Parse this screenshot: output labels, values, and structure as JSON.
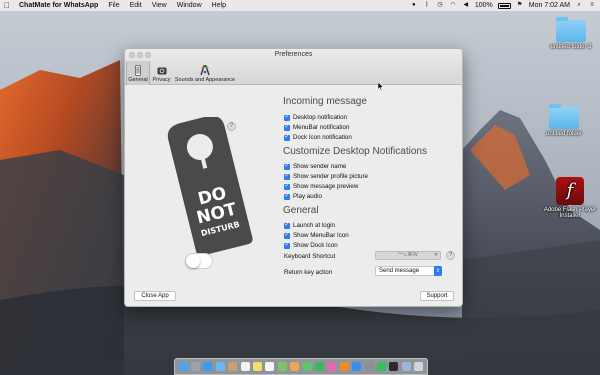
{
  "menubar": {
    "apple_icon": "apple-icon",
    "app_name": "ChatMate for WhatsApp",
    "menus": [
      "File",
      "Edit",
      "View",
      "Window",
      "Help"
    ],
    "battery": "100%",
    "clock": "Mon 7:02 AM"
  },
  "desktop": {
    "icons": [
      {
        "label": "untitled folder 2",
        "type": "folder-icon"
      },
      {
        "label": "untitled folder",
        "type": "folder-icon"
      },
      {
        "label": "Adobe Flash Player Installer",
        "type": "flash-installer-icon"
      }
    ]
  },
  "window": {
    "title": "Preferences",
    "toolbar": {
      "tabs": [
        {
          "label": "General",
          "icon": "phone-icon",
          "active": true
        },
        {
          "label": "Privacy",
          "icon": "camera-icon",
          "active": false
        },
        {
          "label": "Sounds and Appearance",
          "icon": "palette-icon",
          "active": false
        }
      ]
    },
    "sign_text": [
      "DO",
      "NOT",
      "DISTURB"
    ],
    "incoming": {
      "title": "Incoming message",
      "options": [
        "Desktop notification",
        "MenuBar notification",
        "Dock Icon notification"
      ]
    },
    "customize": {
      "title": "Customize Desktop Notifications",
      "options": [
        "Show sender name",
        "Show sender profile picture",
        "Show message preview",
        "Play audio"
      ]
    },
    "general": {
      "title": "General",
      "options": [
        "Launch at login",
        "Show MenuBar Icon",
        "Show Dock Icon"
      ]
    },
    "keyboard_shortcut": {
      "label": "Keyboard Shortcut",
      "value": "^⌥⌘W",
      "clear": "✕",
      "help": "?"
    },
    "return_key": {
      "label": "Return key action",
      "value": "Send message"
    },
    "help_mark": "?",
    "close_button": "Close App",
    "support_button": "Support",
    "dnd_toggle_on": false
  },
  "colors": {
    "accent": "#2f7bf5",
    "sign": "#4a4a4a"
  }
}
